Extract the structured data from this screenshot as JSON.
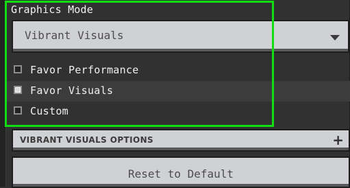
{
  "graphics_mode": {
    "title": "Graphics Mode",
    "dropdown_value": "Vibrant Visuals",
    "dropdown_icon": "chevron-down-icon",
    "options": [
      {
        "label": "Favor Performance",
        "checked": false
      },
      {
        "label": "Favor Visuals",
        "checked": true
      },
      {
        "label": "Custom",
        "checked": false
      }
    ]
  },
  "vibrant_visuals_options": {
    "label": "VIBRANT VISUALS OPTIONS",
    "expand_icon": "plus-icon"
  },
  "reset_button": {
    "label": "Reset to Default"
  },
  "colors": {
    "highlight": "#12dd12",
    "panel_background": "#313131",
    "control_background": "#d0d1d4"
  }
}
